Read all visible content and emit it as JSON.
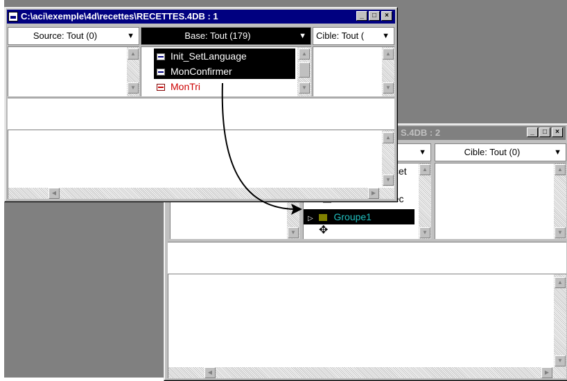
{
  "window1": {
    "title": "C:\\aci\\exemple\\4d\\recettes\\RECETTES.4DB : 1",
    "minimize": "_",
    "maximize": "□",
    "close": "×",
    "source_dropdown": "Source: Tout (0)",
    "base_dropdown": "Base: Tout (179)",
    "cible_dropdown": "Cible: Tout (",
    "base_items": [
      {
        "label": "Init_SetLanguage",
        "selected": true,
        "color": "#ffffff"
      },
      {
        "label": "MonConfirmer",
        "selected": true,
        "color": "#ffffff"
      },
      {
        "label": "MonTri",
        "selected": false,
        "color": "#cc0000"
      }
    ]
  },
  "window2": {
    "title": "S.4DB : 2",
    "minimize": "_",
    "maximize": "□",
    "close": "×",
    "cible_dropdown": "Cible: Tout (0)",
    "partial_item_top": "cet",
    "partial_item_mid": "Toutes Les Rec",
    "group_item": "Groupe1",
    "group_color": "#008080"
  },
  "colors": {
    "selection": "#000000",
    "arrow": "#000000",
    "titlebar_active": "#000080"
  }
}
